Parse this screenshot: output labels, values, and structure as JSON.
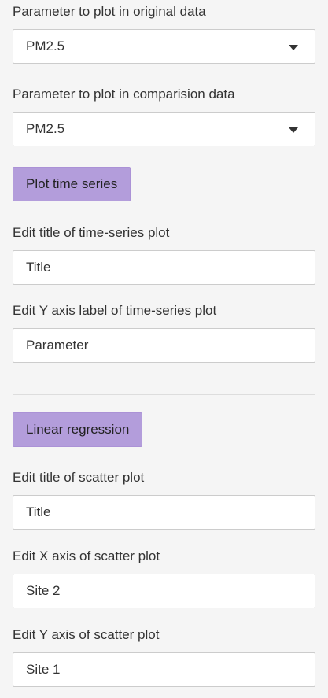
{
  "original_param": {
    "label": "Parameter to plot in original data",
    "selected": "PM2.5"
  },
  "comparison_param": {
    "label": "Parameter to plot in comparision data",
    "selected": "PM2.5"
  },
  "time_series": {
    "button_label": "Plot time series",
    "title_label": "Edit title of time-series plot",
    "title_value": "Title",
    "ylabel_label": "Edit Y axis label of time-series plot",
    "ylabel_value": "Parameter"
  },
  "regression": {
    "button_label": "Linear regression",
    "title_label": "Edit title of scatter plot",
    "title_value": "Title",
    "xaxis_label": "Edit X axis of scatter plot",
    "xaxis_value": "Site 2",
    "yaxis_label": "Edit Y axis of scatter plot",
    "yaxis_value": "Site 1"
  },
  "colors": {
    "background": "#f5f5f5",
    "button": "#b39ddb",
    "field_border": "#cccccc"
  }
}
